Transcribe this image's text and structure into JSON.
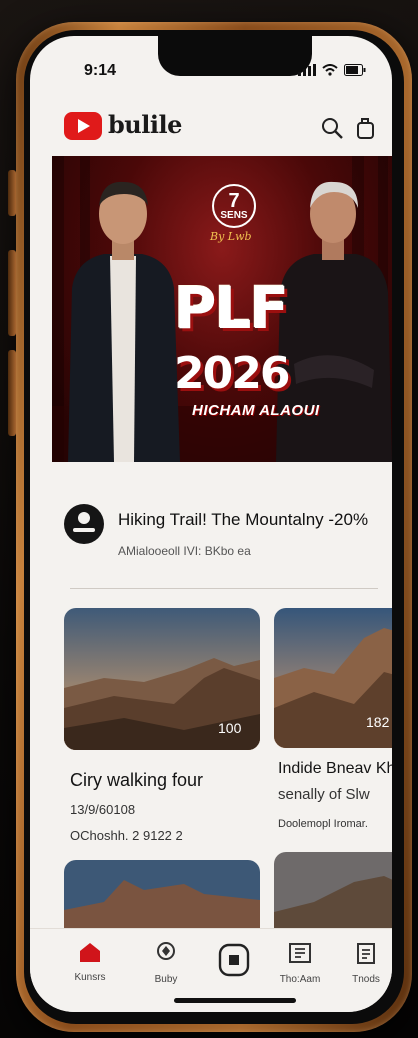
{
  "status_bar": {
    "time": "9:14"
  },
  "app_bar": {
    "logo_text": "bulile",
    "icons": [
      "search-icon",
      "cast-icon"
    ]
  },
  "hero": {
    "badge_number": "7",
    "badge_text": "SENS",
    "signature": "By Lwb",
    "title": "PLF",
    "year": "2026",
    "name": "HICHAM ALAOUI"
  },
  "featured_video": {
    "title": "Hiking Trail! The Mountalny -20%",
    "subtitle": "AMialooeoll IVI: BKbo ea"
  },
  "cards": [
    {
      "count": "100",
      "title": "Ciry walking four",
      "line1": "13/9/60108",
      "line2": "OChoshh. 2 9122 2"
    },
    {
      "count": "182",
      "title": "Indide Bneav Khot",
      "line1": "senally of Slw",
      "line2": "Doolemopl Iromar."
    }
  ],
  "bottom_nav": {
    "items": [
      {
        "label": "Kunsrs",
        "icon": "home-icon",
        "active": true
      },
      {
        "label": "Buby",
        "icon": "location-pin-icon",
        "active": false
      },
      {
        "label": "",
        "icon": "create-icon",
        "active": false
      },
      {
        "label": "Tho:Aam",
        "icon": "library-icon",
        "active": false
      },
      {
        "label": "Tnods",
        "icon": "clipboard-icon",
        "active": false
      }
    ]
  },
  "colors": {
    "brand": "#e01a1a",
    "hero_bg": "#4a0808",
    "screen_bg": "#f4f2ef"
  }
}
